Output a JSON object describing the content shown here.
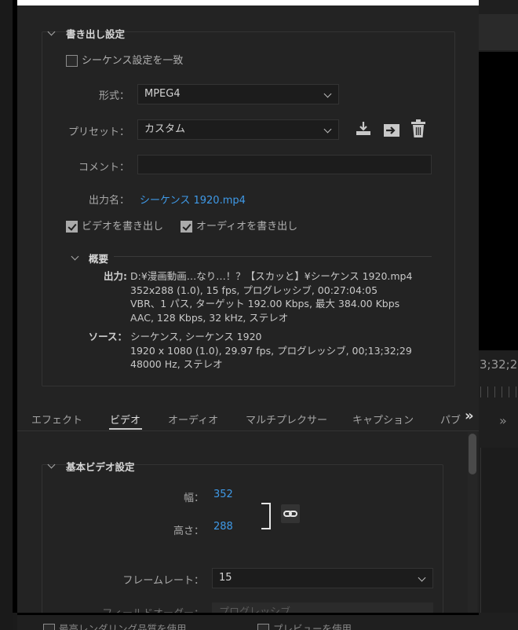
{
  "export_settings": {
    "section_title": "書き出し設定",
    "match_sequence": "シーケンス設定を一致",
    "format_label": "形式：",
    "format_value": "MPEG4",
    "preset_label": "プリセット：",
    "preset_value": "カスタム",
    "comment_label": "コメント：",
    "comment_value": "",
    "output_name_label": "出力名：",
    "output_name_value": "シーケンス 1920.mp4",
    "export_video": "ビデオを書き出し",
    "export_audio": "オーディオを書き出し",
    "export_video_checked": true,
    "export_audio_checked": true,
    "match_sequence_checked": false
  },
  "summary": {
    "title": "概要",
    "output_label": "出力:",
    "output_lines": [
      "D:¥漫画動画…なり…！？【スカッと】¥シーケンス 1920.mp4",
      "352x288 (1.0), 15 fps, プログレッシブ, 00:27:04:05",
      "VBR、1 パス, ターゲット 192.00 Kbps, 最大 384.00 Kbps",
      "AAC, 128 Kbps, 32 kHz, ステレオ"
    ],
    "source_label": "ソース：",
    "source_lines": [
      "シーケンス, シーケンス 1920",
      "1920 x 1080 (1.0), 29.97 fps, プログレッシブ, 00;13;32;29",
      "48000 Hz, ステレオ"
    ]
  },
  "tabs": [
    "エフェクト",
    "ビデオ",
    "オーディオ",
    "マルチプレクサー",
    "キャプション",
    "パブ"
  ],
  "tabs_overflow": "»",
  "video": {
    "section_title": "基本ビデオ設定",
    "width_label": "幅：",
    "width_value": "352",
    "height_label": "高さ：",
    "height_value": "288",
    "framerate_label": "フレームレート：",
    "framerate_value": "15",
    "field_order_label": "フィールドオーダー：",
    "field_order_value": "プログレッシブ"
  },
  "bottom": {
    "max_render": "最高レンダリング品質を使用",
    "use_preview": "プレビューを使用"
  },
  "right_panel": {
    "timecode": "3;32;2",
    "chevron": "»"
  },
  "colors": {
    "accent_link": "#3f9ae8",
    "background": "#232323"
  }
}
